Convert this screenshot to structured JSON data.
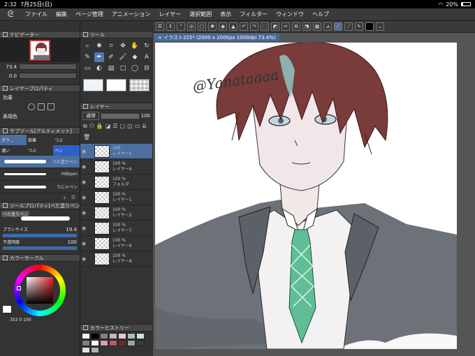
{
  "status": {
    "time": "2:32",
    "date": "7月25日(日)",
    "battery": "20%",
    "battery_level": 0.2
  },
  "menu": {
    "items": [
      "ファイル",
      "編集",
      "ページ管理",
      "アニメーション",
      "レイヤー",
      "選択範囲",
      "表示",
      "フィルター",
      "ウィンドウ",
      "ヘルプ"
    ]
  },
  "navigator": {
    "title": "ナビゲーター",
    "zoom": "73.4",
    "angle": "0.0"
  },
  "layer_props": {
    "title": "レイヤープロパティ",
    "effect_label": "効果",
    "color_label": "表現色"
  },
  "subtool": {
    "title": "サブツール[アルティメット]",
    "tabs": [
      "ダウ...",
      "鉛筆",
      "つぶ",
      "濃い",
      "つぶ",
      "ペン"
    ],
    "brushes": [
      {
        "name": "べた塗りペン",
        "selected": true
      },
      {
        "name": "HiBipen",
        "selected": false
      },
      {
        "name": "うにゃペン",
        "selected": false
      }
    ]
  },
  "tool_property": {
    "title": "ツールプロパティ[べた塗りペン]",
    "brush_label": "べた塗りペン",
    "size_label": "ブラシサイズ",
    "size_value": "19.4",
    "opacity_label": "不透明度",
    "opacity_value": "100"
  },
  "color_circle": {
    "title": "カラーサークル",
    "readout": "353 0 100"
  },
  "tool_panel": {
    "title": "ツール"
  },
  "layer_panel": {
    "title": "レイヤー",
    "blend": "通常",
    "opacity": "100",
    "layers": [
      {
        "pct": "100",
        "name": "レイヤー1",
        "selected": true
      },
      {
        "pct": "100 %",
        "name": "レイヤー9",
        "selected": false
      },
      {
        "pct": "100 %",
        "name": "フォルダ",
        "selected": false
      },
      {
        "pct": "100 %",
        "name": "レイヤー1",
        "selected": false
      },
      {
        "pct": "100 %",
        "name": "レイヤー2",
        "selected": false
      },
      {
        "pct": "100 %",
        "name": "レイヤー7",
        "selected": false
      },
      {
        "pct": "100 %",
        "name": "レイヤー6",
        "selected": false
      },
      {
        "pct": "100 %",
        "name": "レイヤー8",
        "selected": false
      }
    ]
  },
  "color_history": {
    "title": "カラーヒストリー",
    "swatches": [
      "#f4f4f4",
      "#000000",
      "#8a7d80",
      "#c9b3b6",
      "#e7c9cc",
      "#a7c1b8",
      "#cfe0d8",
      "#7d7f83",
      "#ffffff",
      "#d3a0a8",
      "#b85a62",
      "#6e2a2a",
      "#9aa6a4",
      "#3a3a3a",
      "#f0dada",
      "#a7b5b2"
    ]
  },
  "document": {
    "tab": "イラスト225* (2000 x 2000px 1000dpi 73.4%)",
    "signature": "@Yanataaaa"
  }
}
